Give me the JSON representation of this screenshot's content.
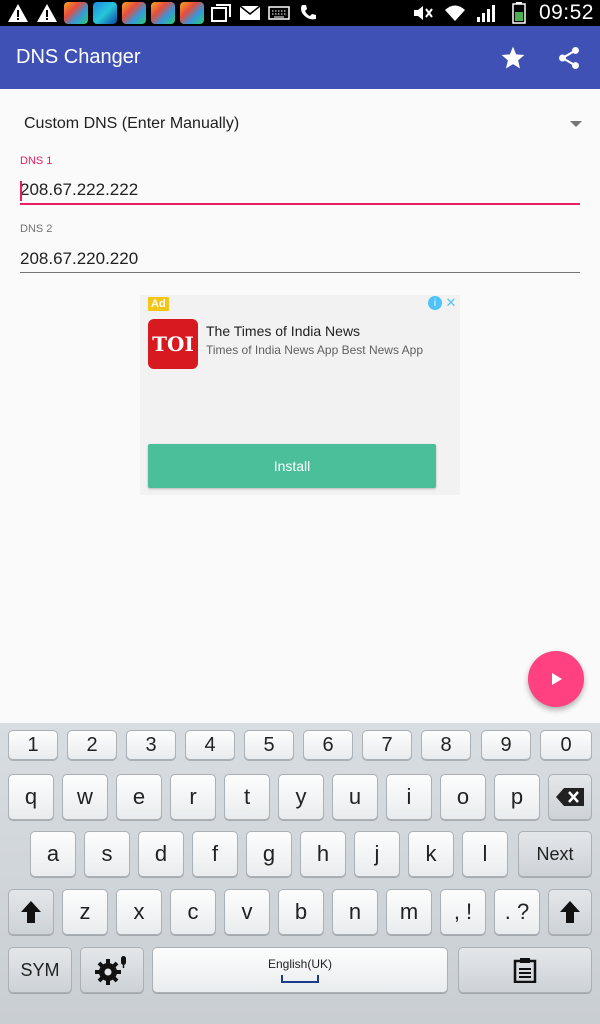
{
  "status_bar": {
    "time": "09:52",
    "icons": [
      "warning-icon",
      "warning-icon",
      "app-icon",
      "app-icon",
      "app-icon",
      "app-icon",
      "app-icon",
      "window-icon",
      "mail-icon",
      "keyboard-icon",
      "call-icon",
      "mute-icon",
      "wifi-icon",
      "signal-icon",
      "battery-icon"
    ]
  },
  "app_bar": {
    "title": "DNS Changer",
    "background": "#3f51b5"
  },
  "dns_selector": {
    "value": "Custom DNS (Enter Manually)"
  },
  "dns1": {
    "label": "DNS 1",
    "value": "208.67.222.222"
  },
  "dns2": {
    "label": "DNS 2",
    "value": "208.67.220.220"
  },
  "ad": {
    "badge": "Ad",
    "logo_text": "TOI",
    "title": "The Times of India News",
    "subtitle": "Times of India News App Best News App",
    "install_label": "Install"
  },
  "fab": {
    "color": "#ff4081"
  },
  "keyboard": {
    "numbers": [
      "1",
      "2",
      "3",
      "4",
      "5",
      "6",
      "7",
      "8",
      "9",
      "0"
    ],
    "row1": [
      "q",
      "w",
      "e",
      "r",
      "t",
      "y",
      "u",
      "i",
      "o",
      "p"
    ],
    "row2": [
      "a",
      "s",
      "d",
      "f",
      "g",
      "h",
      "j",
      "k",
      "l"
    ],
    "row3": [
      "z",
      "x",
      "c",
      "v",
      "b",
      "n",
      "m"
    ],
    "comma_key": ", !",
    "period_key": ". ?",
    "next_label": "Next",
    "sym_label": "SYM",
    "space_label": "English(UK)"
  }
}
